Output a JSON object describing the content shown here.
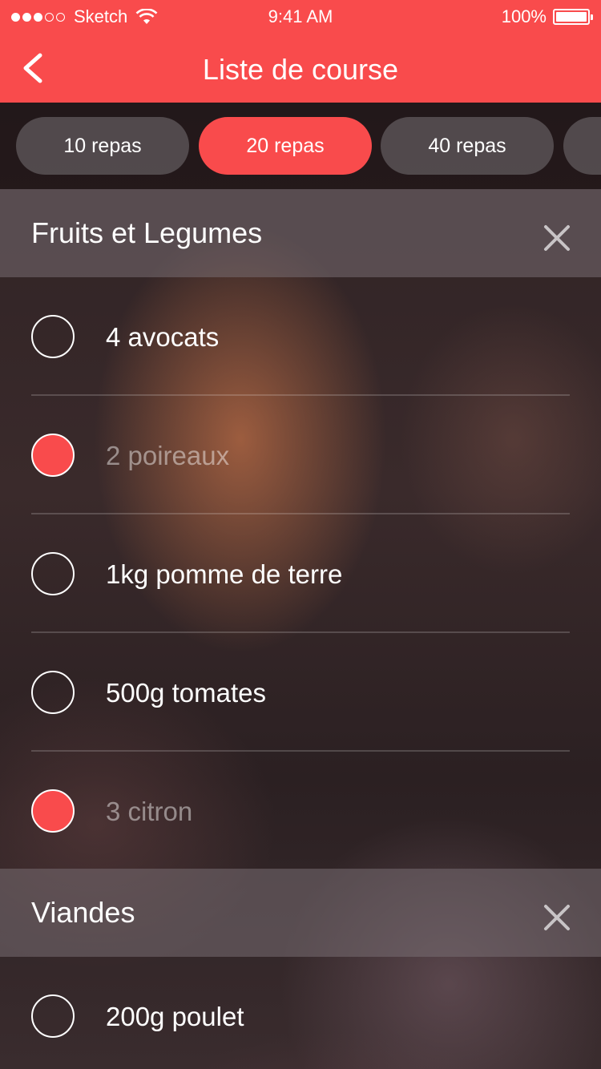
{
  "status_bar": {
    "carrier": "Sketch",
    "time": "9:41 AM",
    "battery": "100%",
    "signal_icon": "signal-dots-icon",
    "wifi_icon": "wifi-icon",
    "battery_icon": "battery-icon"
  },
  "nav": {
    "title": "Liste de course",
    "back_icon": "chevron-left-icon"
  },
  "tabs": [
    {
      "label": "10 repas",
      "active": false
    },
    {
      "label": "20 repas",
      "active": true
    },
    {
      "label": "40 repas",
      "active": false
    },
    {
      "label": "",
      "active": false
    }
  ],
  "sections": [
    {
      "title": "Fruits et Legumes",
      "close_icon": "close-icon",
      "items": [
        {
          "label": "4 avocats",
          "checked": false
        },
        {
          "label": "2 poireaux",
          "checked": true
        },
        {
          "label": "1kg pomme de terre",
          "checked": false
        },
        {
          "label": "500g tomates",
          "checked": false
        },
        {
          "label": "3 citron",
          "checked": true
        }
      ]
    },
    {
      "title": "Viandes",
      "close_icon": "close-icon",
      "items": [
        {
          "label": "200g poulet",
          "checked": false
        }
      ]
    }
  ],
  "colors": {
    "accent": "#f94b4c",
    "tab_inactive": "#6e6a6c"
  }
}
